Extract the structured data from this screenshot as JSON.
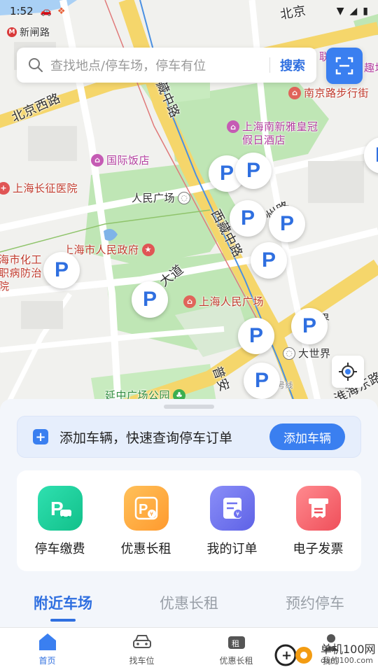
{
  "status_bar": {
    "time": "1:52"
  },
  "search": {
    "placeholder": "查找地点/停车场，停车有位",
    "button": "搜索"
  },
  "map": {
    "roads": [
      "北京西路",
      "西藏中路",
      "西藏中路",
      "大道",
      "州路",
      "淮海东路",
      "普安",
      "北京"
    ],
    "places": [
      {
        "name": "新闸路",
        "type": "metro"
      },
      {
        "name": "南京路步行街",
        "type": "shop"
      },
      {
        "name": "上海南新雅皇冠假日酒店",
        "type": "hotel"
      },
      {
        "name": "国际饭店",
        "type": "hotel"
      },
      {
        "name": "上海长征医院",
        "type": "hospital"
      },
      {
        "name": "人民广场",
        "type": "metro"
      },
      {
        "name": "上海市人民政府",
        "type": "gov"
      },
      {
        "name": "海市化工职病防治院",
        "type": "hospital"
      },
      {
        "name": "上海人民广场",
        "type": "shop"
      },
      {
        "name": "大世界",
        "type": "metro"
      },
      {
        "name": "延中广场公园",
        "type": "park"
      },
      {
        "name": "界",
        "type": "poi"
      },
      {
        "name": "联",
        "type": "poi"
      },
      {
        "name": "趣场",
        "type": "poi"
      },
      {
        "name": "号线",
        "type": "metro-line"
      }
    ],
    "parking_pin_label": "P",
    "parking_pin_count": 11
  },
  "banner": {
    "text": "添加车辆，快速查询停车订单",
    "button": "添加车辆"
  },
  "services": [
    {
      "label": "停车缴费",
      "icon": "parking-pay-icon",
      "color": "#1fcf9a"
    },
    {
      "label": "优惠长租",
      "icon": "discount-rent-icon",
      "color": "#ffa23a"
    },
    {
      "label": "我的订单",
      "icon": "orders-icon",
      "color": "#6e72f0"
    },
    {
      "label": "电子发票",
      "icon": "invoice-icon",
      "color": "#f4616a"
    }
  ],
  "tabs": [
    {
      "label": "附近车场",
      "active": true
    },
    {
      "label": "优惠长租",
      "active": false
    },
    {
      "label": "预约停车",
      "active": false
    }
  ],
  "nav": [
    {
      "label": "首页",
      "icon": "home-icon",
      "active": true
    },
    {
      "label": "找车位",
      "icon": "car-icon",
      "active": false
    },
    {
      "label": "优惠长租",
      "icon": "rent-icon",
      "active": false
    },
    {
      "label": "我的",
      "icon": "profile-icon",
      "active": false
    }
  ],
  "watermark": {
    "text": "单机100网",
    "url": "danji100.com"
  },
  "colors": {
    "accent": "#2f6fe0",
    "button": "#3a7ff0"
  }
}
